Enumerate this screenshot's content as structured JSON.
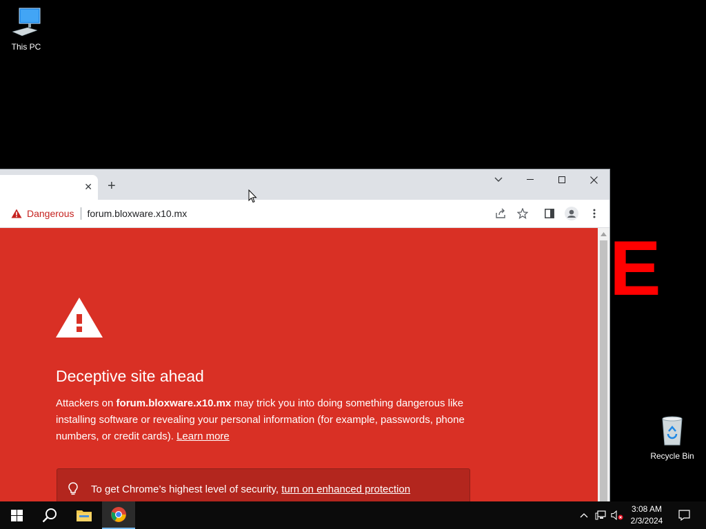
{
  "desktop": {
    "icons": [
      {
        "label": "This PC"
      },
      {
        "label": "Recycle Bin"
      }
    ],
    "background_text": "E"
  },
  "browser": {
    "tab": {
      "close_symbol": "✕"
    },
    "new_tab_symbol": "+",
    "omnibox": {
      "security_label": "Dangerous",
      "url": "forum.bloxware.x10.mx"
    },
    "interstitial": {
      "background_color": "#d93025",
      "heading": "Deceptive site ahead",
      "body_prefix": "Attackers on ",
      "body_site": "forum.bloxware.x10.mx",
      "body_suffix": " may trick you into doing something dangerous like installing software or revealing your personal information (for example, passwords, phone numbers, or credit cards). ",
      "learn_more": "Learn more",
      "protection_prefix": "To get Chrome’s highest level of security, ",
      "protection_link": "turn on enhanced protection"
    }
  },
  "taskbar": {
    "time": "3:08 AM",
    "date": "2/3/2024"
  },
  "colors": {
    "danger_red": "#c5221f",
    "interstitial_red": "#d93025",
    "taskbar": "#0b0b0b"
  }
}
